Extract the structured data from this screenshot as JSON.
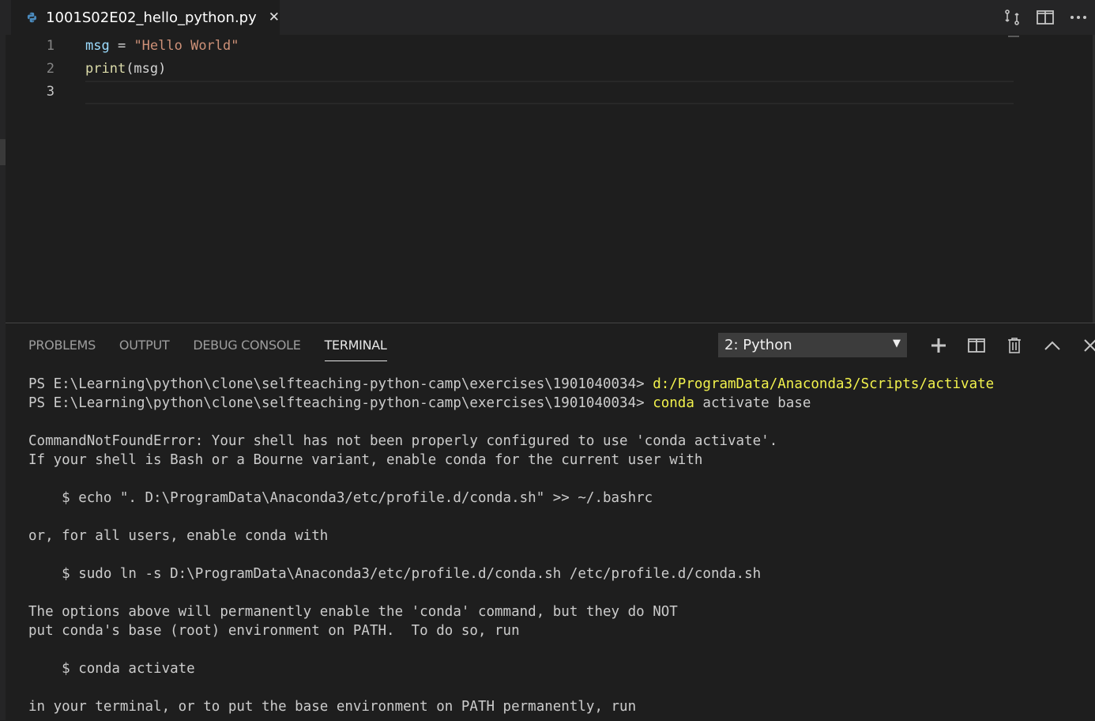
{
  "tab": {
    "filename": "1001S02E02_hello_python.py",
    "close_glyph": "✕",
    "icon": "python-icon"
  },
  "top_actions": [
    "compare-changes-icon",
    "split-editor-icon",
    "more-actions-icon"
  ],
  "editor": {
    "line_numbers": [
      "1",
      "2",
      "3"
    ],
    "lines": [
      {
        "var": "msg",
        "op": " = ",
        "str": "\"Hello World\""
      },
      {
        "fn": "print",
        "rest": "(msg)"
      },
      {
        "text": ""
      }
    ]
  },
  "panel": {
    "tabs": [
      {
        "label": "PROBLEMS"
      },
      {
        "label": "OUTPUT"
      },
      {
        "label": "DEBUG CONSOLE"
      },
      {
        "label": "TERMINAL"
      }
    ],
    "active_tab": "TERMINAL",
    "terminal_select": {
      "value": "2: Python",
      "arrow": "▼"
    },
    "actions": [
      "new-terminal-icon",
      "split-terminal-icon",
      "kill-terminal-icon",
      "maximize-panel-icon",
      "close-panel-icon"
    ]
  },
  "terminal": {
    "prompt1": "PS E:\\Learning\\python\\clone\\selfteaching-python-camp\\exercises\\1901040034> ",
    "cmd1": "d:/ProgramData/Anaconda3/Scripts/activate",
    "prompt2": "PS E:\\Learning\\python\\clone\\selfteaching-python-camp\\exercises\\1901040034> ",
    "cmd2_first": "conda",
    "cmd2_rest": " activate base",
    "lines": [
      "",
      "CommandNotFoundError: Your shell has not been properly configured to use 'conda activate'.",
      "If your shell is Bash or a Bourne variant, enable conda for the current user with",
      "",
      "    $ echo \". D:\\ProgramData\\Anaconda3/etc/profile.d/conda.sh\" >> ~/.bashrc",
      "",
      "or, for all users, enable conda with",
      "",
      "    $ sudo ln -s D:\\ProgramData\\Anaconda3/etc/profile.d/conda.sh /etc/profile.d/conda.sh",
      "",
      "The options above will permanently enable the 'conda' command, but they do NOT",
      "put conda's base (root) environment on PATH.  To do so, run",
      "",
      "    $ conda activate",
      "",
      "in your terminal, or to put the base environment on PATH permanently, run"
    ]
  }
}
